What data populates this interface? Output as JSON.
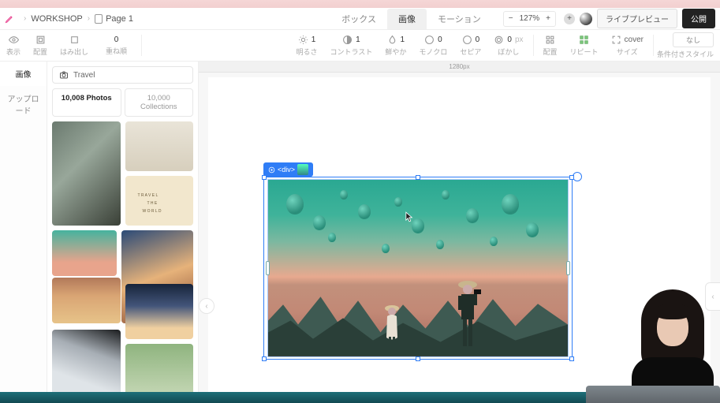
{
  "breadcrumb": {
    "workshop": "WORKSHOP",
    "page": "Page 1"
  },
  "tabs": {
    "box": "ボックス",
    "image": "画像",
    "motion": "モーション"
  },
  "zoom": {
    "value": "127%"
  },
  "header_buttons": {
    "live_preview": "ライブプレビュー",
    "publish": "公開"
  },
  "props": {
    "display": {
      "label": "表示"
    },
    "align": {
      "label": "配置"
    },
    "overflow": {
      "label": "はみ出し"
    },
    "layer": {
      "label": "重ね順",
      "value": "0"
    },
    "brightness": {
      "label": "明るさ",
      "value": "1"
    },
    "contrast": {
      "label": "コントラスト",
      "value": "1"
    },
    "saturation": {
      "label": "鮮やか",
      "value": "1"
    },
    "grayscale": {
      "label": "モノクロ",
      "value": "0"
    },
    "sepia": {
      "label": "セピア",
      "value": "0"
    },
    "blur": {
      "label": "ぼかし",
      "value": "0",
      "unit": "px"
    },
    "position": {
      "label": "配置"
    },
    "repeat": {
      "label": "リピート"
    },
    "size": {
      "label": "サイズ",
      "fit": "cover"
    },
    "cond_none": "なし",
    "cond_style": "条件付きスタイル"
  },
  "left_tabs": {
    "image": "画像",
    "upload": "アップロード"
  },
  "search": {
    "value": "Travel"
  },
  "sub_tabs": {
    "photos": "10,008 Photos",
    "collections": "10,000 Collections"
  },
  "ruler": {
    "width_label": "1280px"
  },
  "selection": {
    "tag": "<div>"
  },
  "scrabble": {
    "l1": "T R A V E L",
    "l2": "T H E",
    "l3": "W O R L D"
  }
}
